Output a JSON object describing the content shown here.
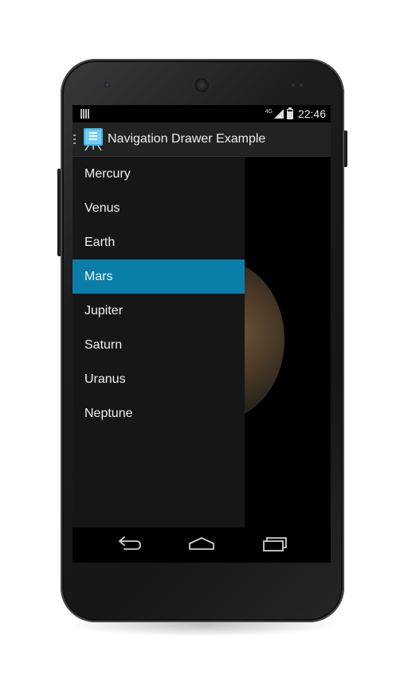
{
  "status_bar": {
    "network_type": "4G",
    "time": "22:46"
  },
  "action_bar": {
    "title": "Navigation Drawer Example",
    "app_icon": "app-launcher-icon",
    "drawer_indicator_icon": "drawer-indicator-icon"
  },
  "drawer": {
    "selected_index": 3,
    "items": [
      {
        "label": "Mercury"
      },
      {
        "label": "Venus"
      },
      {
        "label": "Earth"
      },
      {
        "label": "Mars"
      },
      {
        "label": "Jupiter"
      },
      {
        "label": "Saturn"
      },
      {
        "label": "Uranus"
      },
      {
        "label": "Neptune"
      }
    ]
  },
  "content": {
    "image": "mars-planet-image"
  },
  "nav_bar": {
    "buttons": [
      "back-icon",
      "home-icon",
      "recent-apps-icon"
    ]
  },
  "colors": {
    "selected_item": "#0a7ea8",
    "action_bar": "#222222",
    "drawer_background": "#161616"
  }
}
